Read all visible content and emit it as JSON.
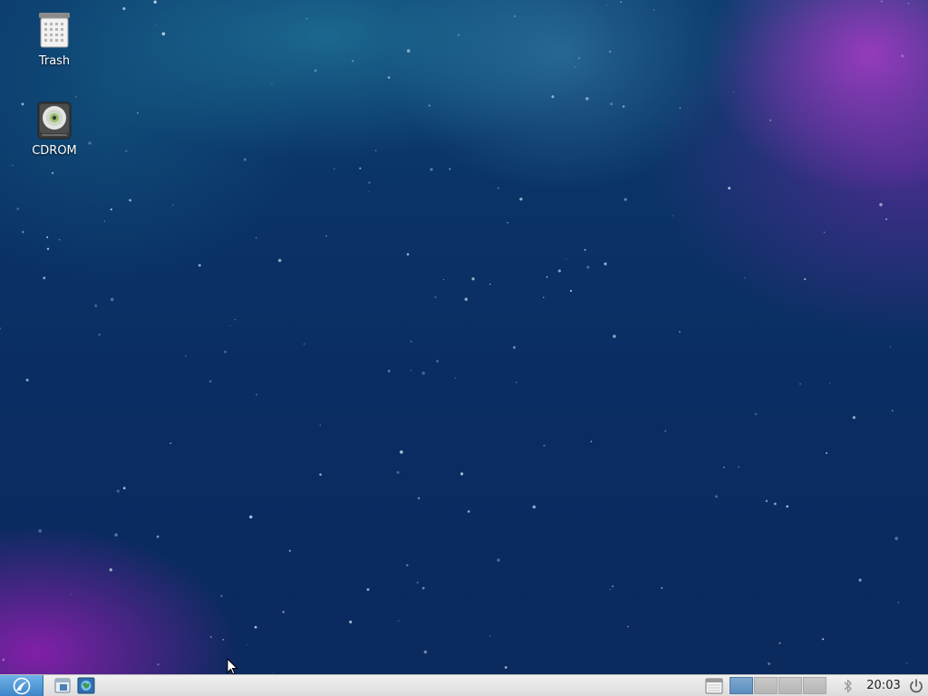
{
  "desktop": {
    "icons": [
      {
        "label": "Trash",
        "icon": "trash-icon"
      },
      {
        "label": "CDROM",
        "icon": "cdrom-icon"
      }
    ]
  },
  "taskbar": {
    "menu_icon": "lubuntu-menu-icon",
    "launchers": [
      "file-manager-icon",
      "browser-icon"
    ],
    "show_desktop_icon": "window-icon",
    "workspaces": {
      "count": 4,
      "active": 1
    },
    "tray_icon": "bluetooth-icon",
    "clock": "20:03",
    "power_icon": "power-icon"
  },
  "colors": {
    "panel": "#e4e4e4",
    "menu_button": "#4a90d0",
    "active_workspace": "#6a98c6",
    "inactive_workspace": "#bebebe"
  }
}
